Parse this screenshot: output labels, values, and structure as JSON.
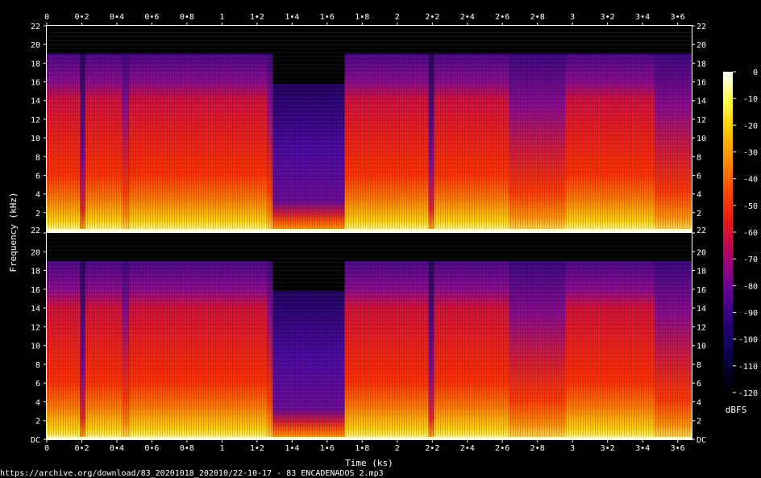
{
  "chart_data": {
    "type": "heatmap",
    "xlabel": "Time (ks)",
    "ylabel": "Frequency (kHz)",
    "colorbar_label": "dBFS",
    "footer": "https://archive.org/download/83_20201018_202010/22-10-17 - 83 ENCADENADOS 2.mp3",
    "xlim": [
      0,
      3.68
    ],
    "ylim": [
      0,
      22
    ],
    "x_ticks": [
      "0",
      "0.2",
      "0.4",
      "0.6",
      "0.8",
      "1",
      "1.2",
      "1.4",
      "1.6",
      "1.8",
      "2",
      "2.2",
      "2.4",
      "2.6",
      "2.8",
      "3",
      "3.2",
      "3.4",
      "3.6"
    ],
    "x_tick_values": [
      0,
      0.2,
      0.4,
      0.6,
      0.8,
      1.0,
      1.2,
      1.4,
      1.6,
      1.8,
      2.0,
      2.2,
      2.4,
      2.6,
      2.8,
      3.0,
      3.2,
      3.4,
      3.6
    ],
    "channels": [
      {
        "y_ticks": [
          "22",
          "20",
          "18",
          "16",
          "14",
          "12",
          "10",
          "8",
          "6",
          "4",
          "2"
        ],
        "y_tick_values": [
          22,
          20,
          18,
          16,
          14,
          12,
          10,
          8,
          6,
          4,
          2
        ]
      },
      {
        "y_ticks": [
          "22",
          "20",
          "18",
          "16",
          "14",
          "12",
          "10",
          "8",
          "6",
          "4",
          "2",
          "DC"
        ],
        "y_tick_values": [
          22,
          20,
          18,
          16,
          14,
          12,
          10,
          8,
          6,
          4,
          2,
          0
        ]
      }
    ],
    "colorbar": {
      "range": [
        -120,
        0
      ],
      "ticks": [
        "0",
        "-10",
        "-20",
        "-30",
        "-40",
        "-50",
        "-60",
        "-70",
        "-80",
        "-90",
        "-100",
        "-110",
        "-120"
      ],
      "tick_values": [
        0,
        -10,
        -20,
        -30,
        -40,
        -50,
        -60,
        -70,
        -80,
        -90,
        -100,
        -110,
        -120
      ],
      "colors": [
        "#ffffff",
        "#ffff60",
        "#ffd000",
        "#ff9000",
        "#ff4800",
        "#e81818",
        "#b0006a",
        "#6a009a",
        "#300080",
        "#0a0450",
        "#000000"
      ]
    },
    "segments": [
      {
        "start": 0.0,
        "end": 0.19,
        "max_freq_khz": 19,
        "level": "loud"
      },
      {
        "start": 0.19,
        "end": 0.22,
        "max_freq_khz": 19,
        "level": "dip"
      },
      {
        "start": 0.22,
        "end": 0.43,
        "max_freq_khz": 19,
        "level": "loud"
      },
      {
        "start": 0.43,
        "end": 0.47,
        "max_freq_khz": 19,
        "level": "mid"
      },
      {
        "start": 0.47,
        "end": 1.26,
        "max_freq_khz": 19,
        "level": "loud"
      },
      {
        "start": 1.26,
        "end": 1.29,
        "max_freq_khz": 19,
        "level": "mid"
      },
      {
        "start": 1.29,
        "end": 1.7,
        "max_freq_khz": 15.8,
        "level": "quiet"
      },
      {
        "start": 1.7,
        "end": 2.18,
        "max_freq_khz": 19,
        "level": "loud"
      },
      {
        "start": 2.18,
        "end": 2.21,
        "max_freq_khz": 19,
        "level": "dip"
      },
      {
        "start": 2.21,
        "end": 2.64,
        "max_freq_khz": 19,
        "level": "loud"
      },
      {
        "start": 2.64,
        "end": 2.96,
        "max_freq_khz": 19,
        "level": "mid"
      },
      {
        "start": 2.96,
        "end": 3.47,
        "max_freq_khz": 19,
        "level": "loud"
      },
      {
        "start": 3.47,
        "end": 3.68,
        "max_freq_khz": 19,
        "level": "mid"
      }
    ]
  }
}
